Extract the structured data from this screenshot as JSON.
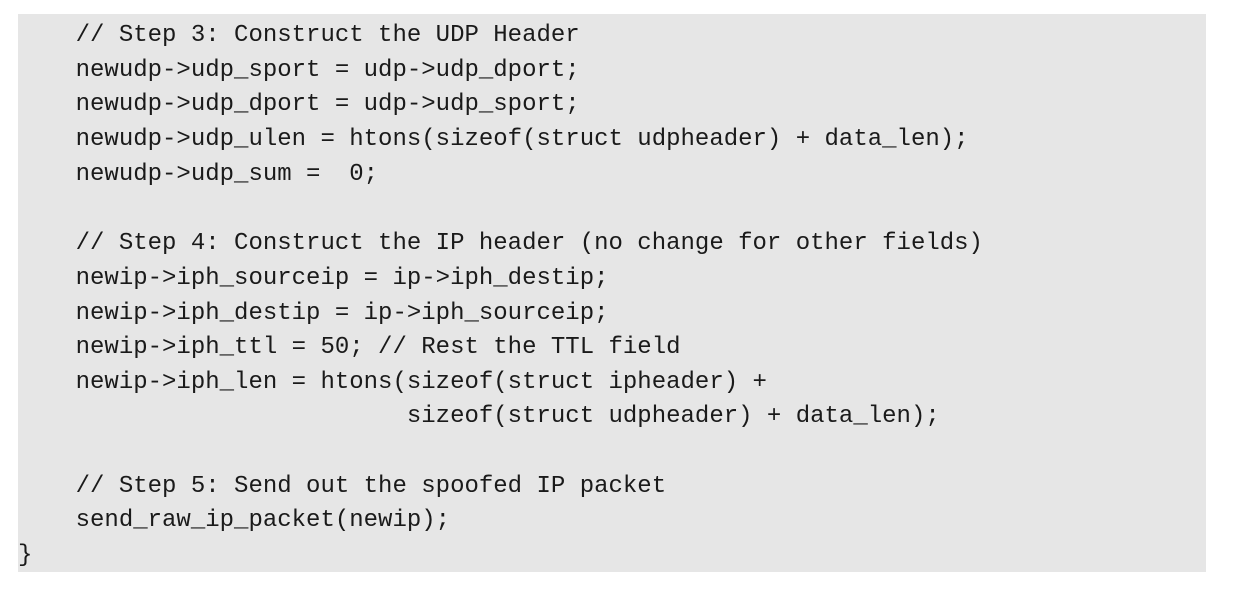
{
  "code": {
    "lines": [
      "    // Step 3: Construct the UDP Header",
      "    newudp->udp_sport = udp->udp_dport;",
      "    newudp->udp_dport = udp->udp_sport;",
      "    newudp->udp_ulen = htons(sizeof(struct udpheader) + data_len);",
      "    newudp->udp_sum =  0;",
      "",
      "    // Step 4: Construct the IP header (no change for other fields)",
      "    newip->iph_sourceip = ip->iph_destip;",
      "    newip->iph_destip = ip->iph_sourceip;",
      "    newip->iph_ttl = 50; // Rest the TTL field",
      "    newip->iph_len = htons(sizeof(struct ipheader) +",
      "                           sizeof(struct udpheader) + data_len);",
      "",
      "    // Step 5: Send out the spoofed IP packet",
      "    send_raw_ip_packet(newip);",
      "}"
    ]
  }
}
